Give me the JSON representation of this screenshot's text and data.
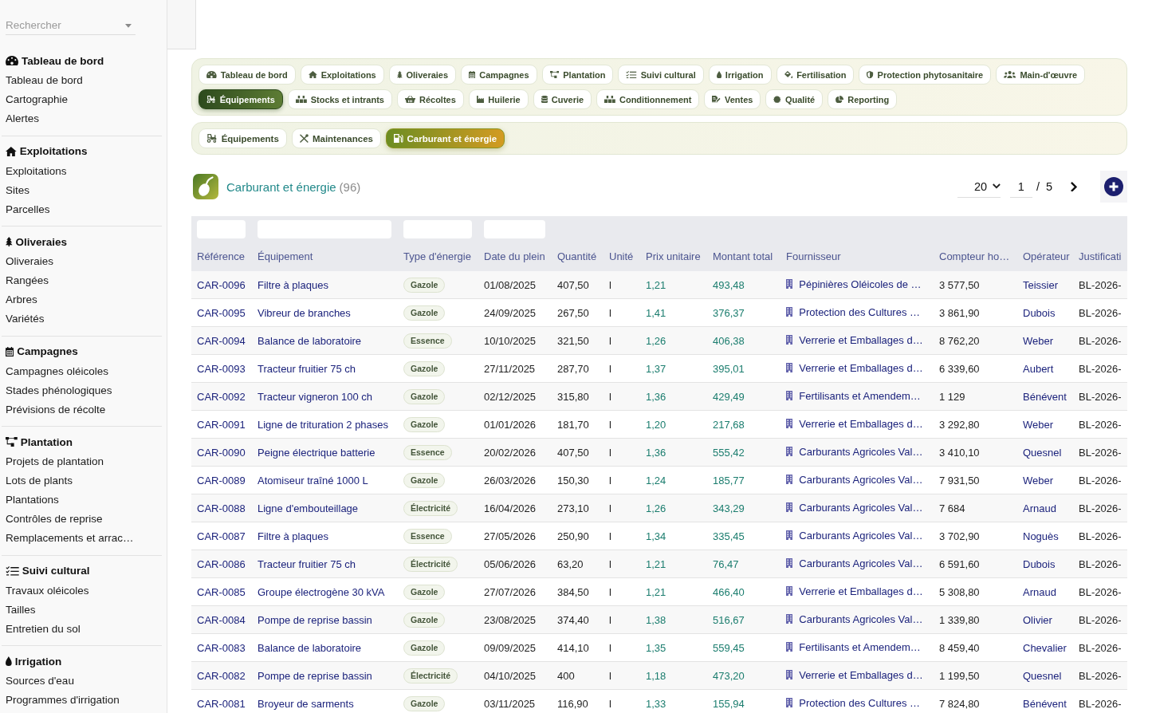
{
  "sidebar": {
    "search": {
      "placeholder": "Rechercher"
    },
    "sections": [
      {
        "title": "Tableau de bord",
        "items": [
          {
            "label": "Tableau de bord"
          },
          {
            "label": "Cartographie"
          },
          {
            "label": "Alertes"
          }
        ]
      },
      {
        "title": "Exploitations",
        "items": [
          {
            "label": "Exploitations"
          },
          {
            "label": "Sites"
          },
          {
            "label": "Parcelles"
          }
        ]
      },
      {
        "title": "Oliveraies",
        "items": [
          {
            "label": "Oliveraies"
          },
          {
            "label": "Rangées"
          },
          {
            "label": "Arbres"
          },
          {
            "label": "Variétés"
          }
        ]
      },
      {
        "title": "Campagnes",
        "items": [
          {
            "label": "Campagnes oléicoles"
          },
          {
            "label": "Stades phénologiques"
          },
          {
            "label": "Prévisions de récolte"
          }
        ]
      },
      {
        "title": "Plantation",
        "items": [
          {
            "label": "Projets de plantation"
          },
          {
            "label": "Lots de plants"
          },
          {
            "label": "Plantations"
          },
          {
            "label": "Contrôles de reprise"
          },
          {
            "label": "Remplacements et arrac…"
          }
        ]
      },
      {
        "title": "Suivi cultural",
        "items": [
          {
            "label": "Travaux oléicoles"
          },
          {
            "label": "Tailles"
          },
          {
            "label": "Entretien du sol"
          }
        ]
      },
      {
        "title": "Irrigation",
        "items": [
          {
            "label": "Sources d'eau"
          },
          {
            "label": "Programmes d'irrigation"
          }
        ]
      }
    ]
  },
  "nav": {
    "tab_rows": [
      [
        {
          "label": "Tableau de bord",
          "selected": false
        },
        {
          "label": "Exploitations",
          "selected": false
        },
        {
          "label": "Oliveraies",
          "selected": false
        },
        {
          "label": "Campagnes",
          "selected": false
        },
        {
          "label": "Plantation",
          "selected": false
        },
        {
          "label": "Suivi cultural",
          "selected": false
        },
        {
          "label": "Irrigation",
          "selected": false
        },
        {
          "label": "Fertilisation",
          "selected": false
        },
        {
          "label": "Protection phytosanitaire",
          "selected": false
        },
        {
          "label": "Main-d'œuvre",
          "selected": false
        }
      ],
      [
        {
          "label": "Équipements",
          "selected": true
        },
        {
          "label": "Stocks et intrants",
          "selected": false
        },
        {
          "label": "Récoltes",
          "selected": false
        },
        {
          "label": "Huilerie",
          "selected": false
        },
        {
          "label": "Cuverie",
          "selected": false
        },
        {
          "label": "Conditionnement",
          "selected": false
        },
        {
          "label": "Ventes",
          "selected": false
        },
        {
          "label": "Qualité",
          "selected": false
        },
        {
          "label": "Reporting",
          "selected": false
        }
      ]
    ]
  },
  "subnav": {
    "tabs": [
      {
        "label": "Équipements",
        "selected": false
      },
      {
        "label": "Maintenances",
        "selected": false
      },
      {
        "label": "Carburant et énergie",
        "selected": true
      }
    ]
  },
  "header": {
    "title": "Carburant et énergie",
    "count": "(96)"
  },
  "pagination": {
    "page_size": "20",
    "page": "1",
    "separator": "/",
    "page_count": "5"
  },
  "table": {
    "columns": [
      {
        "label": "Référence",
        "kind": "link",
        "filter": true
      },
      {
        "label": "Équipement",
        "kind": "link",
        "filter": true
      },
      {
        "label": "Type d'énergie",
        "kind": "badge",
        "filter": true
      },
      {
        "label": "Date du plein",
        "kind": "text",
        "filter": true
      },
      {
        "label": "Quantité",
        "kind": "text",
        "filter": false
      },
      {
        "label": "Unité",
        "kind": "text",
        "filter": false
      },
      {
        "label": "Prix unitaire",
        "kind": "amount",
        "filter": false
      },
      {
        "label": "Montant total",
        "kind": "amount",
        "filter": false
      },
      {
        "label": "Fournisseur",
        "kind": "supplier",
        "filter": false
      },
      {
        "label": "Compteur ho…",
        "kind": "text",
        "filter": false
      },
      {
        "label": "Opérateur",
        "kind": "link",
        "filter": false
      },
      {
        "label": "Justificati",
        "kind": "text",
        "filter": false
      }
    ],
    "rows": [
      [
        "CAR-0096",
        "Filtre à plaques",
        "Gazole",
        "01/08/2025",
        "407,50",
        "l",
        "1,21",
        "493,48",
        "Pépinières Oléicoles de …",
        "3 577,50",
        "Teissier",
        "BL-2026-"
      ],
      [
        "CAR-0095",
        "Vibreur de branches",
        "Gazole",
        "24/09/2025",
        "267,50",
        "l",
        "1,41",
        "376,37",
        "Protection des Cultures …",
        "3 861,90",
        "Dubois",
        "BL-2026-"
      ],
      [
        "CAR-0094",
        "Balance de laboratoire",
        "Essence",
        "10/10/2025",
        "321,50",
        "l",
        "1,26",
        "406,38",
        "Verrerie et Emballages d…",
        "8 762,20",
        "Weber",
        "BL-2026-"
      ],
      [
        "CAR-0093",
        "Tracteur fruitier 75 ch",
        "Gazole",
        "27/11/2025",
        "287,70",
        "l",
        "1,37",
        "395,01",
        "Verrerie et Emballages d…",
        "6 339,60",
        "Aubert",
        "BL-2026-"
      ],
      [
        "CAR-0092",
        "Tracteur vigneron 100 ch",
        "Gazole",
        "02/12/2025",
        "315,80",
        "l",
        "1,36",
        "429,49",
        "Fertilisants et Amendem…",
        "1 129",
        "Bénévent",
        "BL-2026-"
      ],
      [
        "CAR-0091",
        "Ligne de trituration 2 phases",
        "Gazole",
        "01/01/2026",
        "181,70",
        "l",
        "1,20",
        "217,68",
        "Verrerie et Emballages d…",
        "3 292,80",
        "Weber",
        "BL-2026-"
      ],
      [
        "CAR-0090",
        "Peigne électrique batterie",
        "Essence",
        "20/02/2026",
        "407,50",
        "l",
        "1,36",
        "555,42",
        "Carburants Agricoles Val…",
        "3 410,10",
        "Quesnel",
        "BL-2026-"
      ],
      [
        "CAR-0089",
        "Atomiseur traîné 1000 L",
        "Gazole",
        "26/03/2026",
        "150,30",
        "l",
        "1,24",
        "185,77",
        "Carburants Agricoles Val…",
        "7 931,50",
        "Weber",
        "BL-2026-"
      ],
      [
        "CAR-0088",
        "Ligne d'embouteillage",
        "Électricité",
        "16/04/2026",
        "273,10",
        "l",
        "1,26",
        "343,29",
        "Carburants Agricoles Val…",
        "7 684",
        "Arnaud",
        "BL-2026-"
      ],
      [
        "CAR-0087",
        "Filtre à plaques",
        "Essence",
        "27/05/2026",
        "250,90",
        "l",
        "1,34",
        "335,45",
        "Carburants Agricoles Val…",
        "3 702,90",
        "Noguès",
        "BL-2026-"
      ],
      [
        "CAR-0086",
        "Tracteur fruitier 75 ch",
        "Électricité",
        "05/06/2026",
        "63,20",
        "l",
        "1,21",
        "76,47",
        "Carburants Agricoles Val…",
        "6 591,60",
        "Dubois",
        "BL-2026-"
      ],
      [
        "CAR-0085",
        "Groupe électrogène 30 kVA",
        "Gazole",
        "27/07/2026",
        "384,50",
        "l",
        "1,21",
        "466,40",
        "Verrerie et Emballages d…",
        "5 308,80",
        "Arnaud",
        "BL-2026-"
      ],
      [
        "CAR-0084",
        "Pompe de reprise bassin",
        "Gazole",
        "23/08/2025",
        "374,40",
        "l",
        "1,38",
        "516,67",
        "Carburants Agricoles Val…",
        "1 339,80",
        "Olivier",
        "BL-2026-"
      ],
      [
        "CAR-0083",
        "Balance de laboratoire",
        "Gazole",
        "09/09/2025",
        "414,10",
        "l",
        "1,35",
        "559,45",
        "Fertilisants et Amendem…",
        "8 459,40",
        "Chevalier",
        "BL-2026-"
      ],
      [
        "CAR-0082",
        "Pompe de reprise bassin",
        "Électricité",
        "04/10/2025",
        "400",
        "l",
        "1,18",
        "473,20",
        "Verrerie et Emballages d…",
        "1 199,50",
        "Quesnel",
        "BL-2026-"
      ],
      [
        "CAR-0081",
        "Broyeur de sarments",
        "Gazole",
        "03/11/2025",
        "116,90",
        "l",
        "1,33",
        "155,94",
        "Protection des Cultures …",
        "7 824,80",
        "Bénévent",
        "BL-2026-"
      ]
    ]
  }
}
